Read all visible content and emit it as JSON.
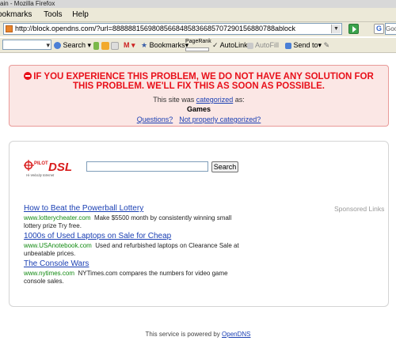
{
  "window": {
    "title": "ain - Mozilla Firefox"
  },
  "menu": {
    "items": [
      "ookmarks",
      "Tools",
      "Help"
    ]
  },
  "navbar": {
    "url": "http://block.opendns.com/?url=88888815698085668485836685707290156880788ablock",
    "search_fragment": "Goo"
  },
  "toolbar": {
    "search_label": "Search",
    "bookmarks_label": "Bookmarks",
    "pagerank_label": "PageRank",
    "autolink_label": "AutoLink",
    "autofill_label": "AutoFill",
    "sendto_label": "Send to"
  },
  "error": {
    "title": "IF YOU EXPERIENCE THIS PROBLEM, WE DO NOT HAVE ANY SOLUTION FOR THIS PROBLEM. WE'LL FIX THIS AS SOON AS POSSIBLE.",
    "categorized_prefix": "This site was",
    "categorized_link": "categorized",
    "categorized_suffix": "as:",
    "category": "Games",
    "questions_link": "Questions?",
    "not_properly_link": "Not properly categorized?"
  },
  "main": {
    "logo_text": "DSL",
    "logo_pilot": "PILOT",
    "logo_tagline": "Hi-Velocity Internet",
    "search_button": "Search",
    "sponsored_label": "Sponsored Links",
    "ads": [
      {
        "title": "How to Beat the Powerball Lottery",
        "url": "www.lotterycheater.com",
        "text": "Make $5500 month by consistently winning small lottery prize Try free."
      },
      {
        "title": "1000s of Used Laptops on Sale for Cheap",
        "url": "www.USAnotebook.com",
        "text": "Used and refurbished laptops on Clearance Sale at unbeatable prices."
      },
      {
        "title": "The Console Wars",
        "url": "www.nytimes.com",
        "text": "NYTimes.com compares the numbers for video game console sales."
      }
    ]
  },
  "footer": {
    "prefix": "This service is powered by",
    "link": "OpenDNS"
  },
  "colors": {
    "error_red": "#e8101a",
    "link_blue": "#1a3fb3",
    "ad_url_green": "#118a11"
  }
}
